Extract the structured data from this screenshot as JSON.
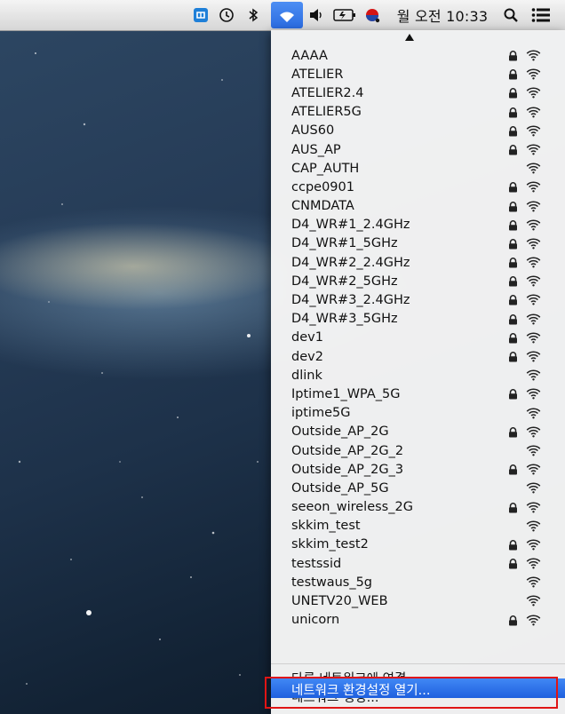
{
  "menubar": {
    "clock": "월 오전 10:33",
    "icons": [
      "app-icon",
      "time-machine-icon",
      "bluetooth-icon",
      "wifi-icon",
      "volume-icon",
      "battery-icon",
      "user-status-icon",
      "spotlight-icon",
      "notification-center-icon"
    ]
  },
  "wifi_menu": {
    "networks": [
      {
        "name": "AAAA",
        "locked": true
      },
      {
        "name": "ATELIER",
        "locked": true
      },
      {
        "name": "ATELIER2.4",
        "locked": true
      },
      {
        "name": "ATELIER5G",
        "locked": true
      },
      {
        "name": "AUS60",
        "locked": true
      },
      {
        "name": "AUS_AP",
        "locked": true
      },
      {
        "name": "CAP_AUTH",
        "locked": false
      },
      {
        "name": "ccpe0901",
        "locked": true
      },
      {
        "name": "CNMDATA",
        "locked": true
      },
      {
        "name": "D4_WR#1_2.4GHz",
        "locked": true
      },
      {
        "name": "D4_WR#1_5GHz",
        "locked": true
      },
      {
        "name": "D4_WR#2_2.4GHz",
        "locked": true
      },
      {
        "name": "D4_WR#2_5GHz",
        "locked": true
      },
      {
        "name": "D4_WR#3_2.4GHz",
        "locked": true
      },
      {
        "name": "D4_WR#3_5GHz",
        "locked": true
      },
      {
        "name": "dev1",
        "locked": true
      },
      {
        "name": "dev2",
        "locked": true
      },
      {
        "name": "dlink",
        "locked": false
      },
      {
        "name": "Iptime1_WPA_5G",
        "locked": true
      },
      {
        "name": "iptime5G",
        "locked": false
      },
      {
        "name": "Outside_AP_2G",
        "locked": true
      },
      {
        "name": "Outside_AP_2G_2",
        "locked": false
      },
      {
        "name": "Outside_AP_2G_3",
        "locked": true
      },
      {
        "name": "Outside_AP_5G",
        "locked": false
      },
      {
        "name": "seeon_wireless_2G",
        "locked": true
      },
      {
        "name": "skkim_test",
        "locked": false
      },
      {
        "name": "skkim_test2",
        "locked": true
      },
      {
        "name": "testssid",
        "locked": true
      },
      {
        "name": "testwaus_5g",
        "locked": false
      },
      {
        "name": "UNETV20_WEB",
        "locked": false
      },
      {
        "name": "unicorn",
        "locked": true
      }
    ],
    "actions": {
      "join_other": "다른 네트워크에 연결...",
      "create_network": "네트워크 생성...",
      "open_preferences": "네트워크 환경설정 열기..."
    }
  },
  "colors": {
    "selection": "#2a6be0",
    "highlight_border": "#e01515"
  }
}
